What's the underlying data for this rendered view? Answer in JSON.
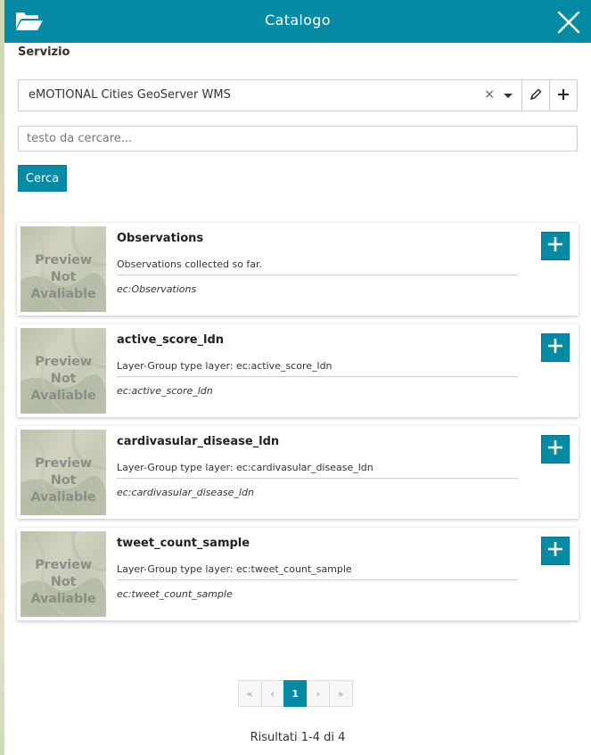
{
  "header": {
    "title": "Catalogo",
    "folder_icon": "folder-open-icon",
    "close_icon": "close-icon",
    "color": "#078aa3"
  },
  "service": {
    "label": "Servizio",
    "selected": "eMOTIONAL Cities GeoServer WMS",
    "clear_glyph": "×",
    "edit_icon": "pencil-icon",
    "add_icon": "plus-icon"
  },
  "search": {
    "placeholder": "testo da cercare...",
    "value": "",
    "button_label": "Cerca"
  },
  "results": [
    {
      "title": "Observations",
      "description": "Observations collected so far.",
      "layer": "ec:Observations",
      "thumbnail_text_line1": "Preview Not",
      "thumbnail_text_line2": "Avaliable"
    },
    {
      "title": "active_score_ldn",
      "description": "Layer-Group type layer: ec:active_score_ldn",
      "layer": "ec:active_score_ldn",
      "thumbnail_text_line1": "Preview Not",
      "thumbnail_text_line2": "Avaliable"
    },
    {
      "title": "cardivasular_disease_ldn",
      "description": "Layer-Group type layer: ec:cardivasular_disease_ldn",
      "layer": "ec:cardivasular_disease_ldn",
      "thumbnail_text_line1": "Preview Not",
      "thumbnail_text_line2": "Avaliable"
    },
    {
      "title": "tweet_count_sample",
      "description": "Layer-Group type layer: ec:tweet_count_sample",
      "layer": "ec:tweet_count_sample",
      "thumbnail_text_line1": "Preview Not",
      "thumbnail_text_line2": "Avaliable"
    }
  ],
  "pagination": {
    "first": "«",
    "prev": "‹",
    "current": "1",
    "next": "›",
    "last": "»"
  },
  "summary": "Risultati 1-4 di 4"
}
